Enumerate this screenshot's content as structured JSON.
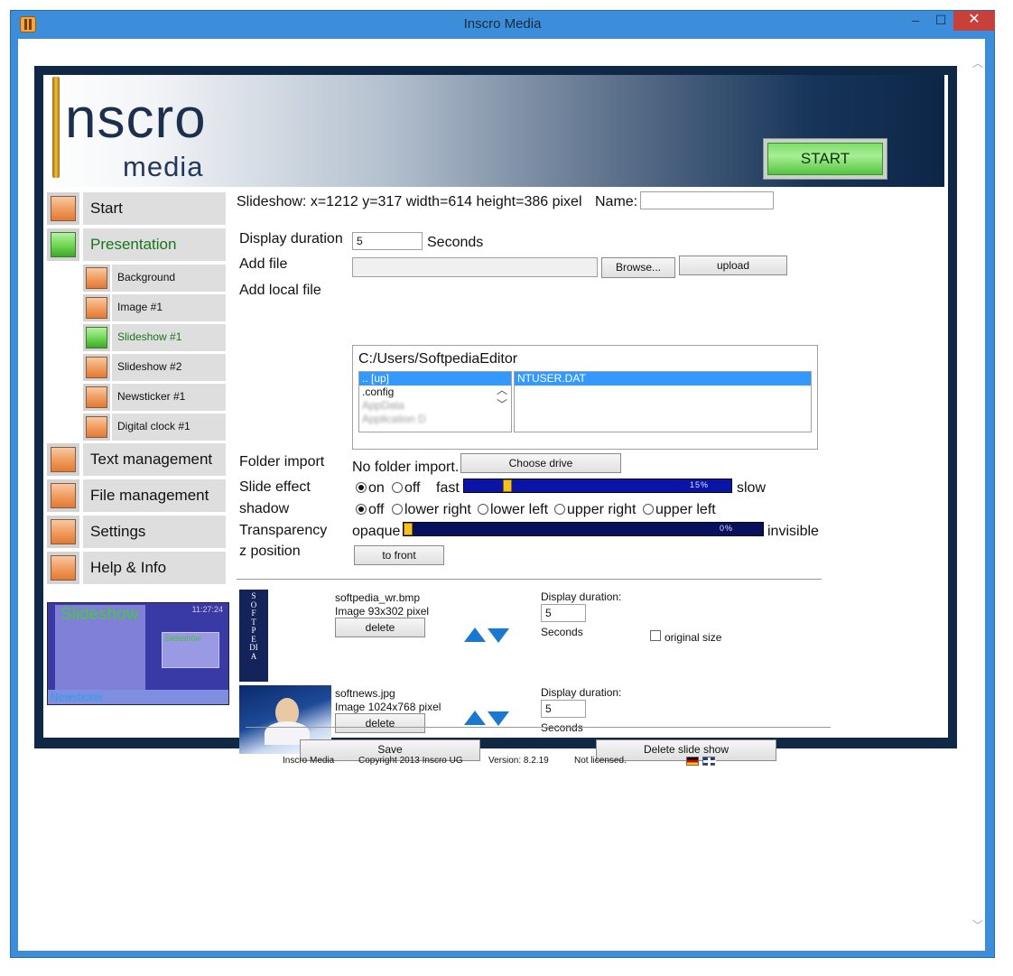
{
  "window": {
    "title": "Inscro Media",
    "minimize": "–",
    "maximize": "☐",
    "close": "✕"
  },
  "banner": {
    "logo_big": "nscro",
    "logo_small": "media",
    "start_button": "START"
  },
  "nav": {
    "start": "Start",
    "presentation": "Presentation",
    "sub": [
      "Background",
      "Image #1",
      "Slideshow #1",
      "Slideshow #2",
      "Newsticker #1",
      "Digital clock #1"
    ],
    "text_management": "Text management",
    "file_management": "File management",
    "settings": "Settings",
    "help": "Help & Info"
  },
  "preview": {
    "title": "Slideshow",
    "clock": "11:27:24",
    "slide": "Slideshow",
    "newsticker": "Newsticker"
  },
  "main": {
    "geometry": "Slideshow: x=1212 y=317 width=614 height=386 pixel",
    "name_label": "Name:",
    "name_value": "",
    "display_duration_label": "Display duration",
    "display_duration_value": "5",
    "seconds": "Seconds",
    "add_file_label": "Add file",
    "browse": "Browse...",
    "upload": "upload",
    "add_local_file_label": "Add local file",
    "local_path": "C:/Users/SoftpediaEditor",
    "folders": [
      ".. [up]",
      ".config",
      "AppData",
      "Application D"
    ],
    "files": [
      "NTUSER.DAT"
    ],
    "folder_import_label": "Folder import",
    "folder_import_value": "No folder import.",
    "choose_drive": "Choose drive",
    "slide_effect_label": "Slide effect",
    "on": "on",
    "off": "off",
    "fast": "fast",
    "slow": "slow",
    "slide_speed_percent": "15%",
    "slide_speed_fraction": 0.15,
    "shadow_label": "shadow",
    "shadow_options": [
      "off",
      "lower right",
      "lower left",
      "upper right",
      "upper left"
    ],
    "transparency_label": "Transparency",
    "opaque": "opaque",
    "invisible": "invisible",
    "transparency_percent": "0%",
    "transparency_fraction": 0,
    "z_position_label": "z position",
    "to_front": "to front"
  },
  "images": [
    {
      "name": "softpedia_wr.bmp",
      "info": "Image 93x302 pixel",
      "delete": "delete",
      "duration_label": "Display duration:",
      "duration": "5",
      "seconds": "Seconds",
      "thumb_text": "SOFTPEDIA"
    },
    {
      "name": "softnews.jpg",
      "info": "Image 1024x768 pixel",
      "delete": "delete",
      "duration_label": "Display duration:",
      "duration": "5",
      "seconds": "Seconds"
    }
  ],
  "original_size": "original size",
  "save": "Save",
  "delete_slideshow": "Delete slide show",
  "footer": {
    "app": "Inscro Media",
    "copyright": "Copyright 2013 Inscro UG",
    "version": "Version: 8.2.19",
    "license": "Not licensed."
  },
  "colors": {
    "titlebar": "#3c8edb",
    "frame": "#0f2846",
    "active_nav": "#18761a",
    "slider": "#0a14a8",
    "thumb": "#f6c21f"
  }
}
